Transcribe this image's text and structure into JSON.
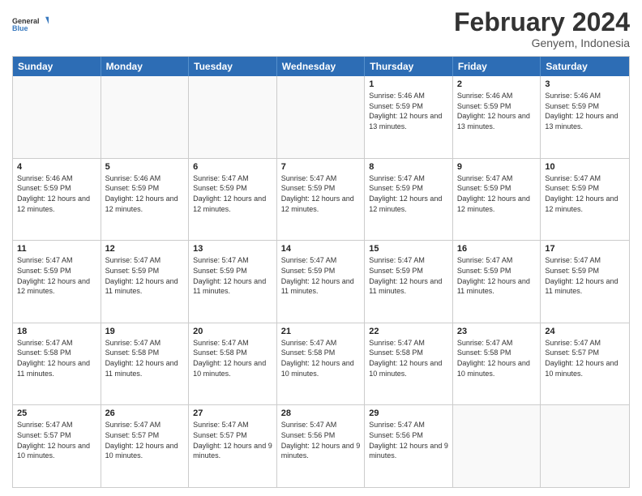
{
  "logo": {
    "line1": "General",
    "line2": "Blue"
  },
  "title": "February 2024",
  "location": "Genyem, Indonesia",
  "days_of_week": [
    "Sunday",
    "Monday",
    "Tuesday",
    "Wednesday",
    "Thursday",
    "Friday",
    "Saturday"
  ],
  "weeks": [
    [
      {
        "day": "",
        "empty": true
      },
      {
        "day": "",
        "empty": true
      },
      {
        "day": "",
        "empty": true
      },
      {
        "day": "",
        "empty": true
      },
      {
        "day": "1",
        "sunrise": "5:46 AM",
        "sunset": "5:59 PM",
        "daylight": "12 hours and 13 minutes."
      },
      {
        "day": "2",
        "sunrise": "5:46 AM",
        "sunset": "5:59 PM",
        "daylight": "12 hours and 13 minutes."
      },
      {
        "day": "3",
        "sunrise": "5:46 AM",
        "sunset": "5:59 PM",
        "daylight": "12 hours and 13 minutes."
      }
    ],
    [
      {
        "day": "4",
        "sunrise": "5:46 AM",
        "sunset": "5:59 PM",
        "daylight": "12 hours and 12 minutes."
      },
      {
        "day": "5",
        "sunrise": "5:46 AM",
        "sunset": "5:59 PM",
        "daylight": "12 hours and 12 minutes."
      },
      {
        "day": "6",
        "sunrise": "5:47 AM",
        "sunset": "5:59 PM",
        "daylight": "12 hours and 12 minutes."
      },
      {
        "day": "7",
        "sunrise": "5:47 AM",
        "sunset": "5:59 PM",
        "daylight": "12 hours and 12 minutes."
      },
      {
        "day": "8",
        "sunrise": "5:47 AM",
        "sunset": "5:59 PM",
        "daylight": "12 hours and 12 minutes."
      },
      {
        "day": "9",
        "sunrise": "5:47 AM",
        "sunset": "5:59 PM",
        "daylight": "12 hours and 12 minutes."
      },
      {
        "day": "10",
        "sunrise": "5:47 AM",
        "sunset": "5:59 PM",
        "daylight": "12 hours and 12 minutes."
      }
    ],
    [
      {
        "day": "11",
        "sunrise": "5:47 AM",
        "sunset": "5:59 PM",
        "daylight": "12 hours and 12 minutes."
      },
      {
        "day": "12",
        "sunrise": "5:47 AM",
        "sunset": "5:59 PM",
        "daylight": "12 hours and 11 minutes."
      },
      {
        "day": "13",
        "sunrise": "5:47 AM",
        "sunset": "5:59 PM",
        "daylight": "12 hours and 11 minutes."
      },
      {
        "day": "14",
        "sunrise": "5:47 AM",
        "sunset": "5:59 PM",
        "daylight": "12 hours and 11 minutes."
      },
      {
        "day": "15",
        "sunrise": "5:47 AM",
        "sunset": "5:59 PM",
        "daylight": "12 hours and 11 minutes."
      },
      {
        "day": "16",
        "sunrise": "5:47 AM",
        "sunset": "5:59 PM",
        "daylight": "12 hours and 11 minutes."
      },
      {
        "day": "17",
        "sunrise": "5:47 AM",
        "sunset": "5:59 PM",
        "daylight": "12 hours and 11 minutes."
      }
    ],
    [
      {
        "day": "18",
        "sunrise": "5:47 AM",
        "sunset": "5:58 PM",
        "daylight": "12 hours and 11 minutes."
      },
      {
        "day": "19",
        "sunrise": "5:47 AM",
        "sunset": "5:58 PM",
        "daylight": "12 hours and 11 minutes."
      },
      {
        "day": "20",
        "sunrise": "5:47 AM",
        "sunset": "5:58 PM",
        "daylight": "12 hours and 10 minutes."
      },
      {
        "day": "21",
        "sunrise": "5:47 AM",
        "sunset": "5:58 PM",
        "daylight": "12 hours and 10 minutes."
      },
      {
        "day": "22",
        "sunrise": "5:47 AM",
        "sunset": "5:58 PM",
        "daylight": "12 hours and 10 minutes."
      },
      {
        "day": "23",
        "sunrise": "5:47 AM",
        "sunset": "5:58 PM",
        "daylight": "12 hours and 10 minutes."
      },
      {
        "day": "24",
        "sunrise": "5:47 AM",
        "sunset": "5:57 PM",
        "daylight": "12 hours and 10 minutes."
      }
    ],
    [
      {
        "day": "25",
        "sunrise": "5:47 AM",
        "sunset": "5:57 PM",
        "daylight": "12 hours and 10 minutes."
      },
      {
        "day": "26",
        "sunrise": "5:47 AM",
        "sunset": "5:57 PM",
        "daylight": "12 hours and 10 minutes."
      },
      {
        "day": "27",
        "sunrise": "5:47 AM",
        "sunset": "5:57 PM",
        "daylight": "12 hours and 9 minutes."
      },
      {
        "day": "28",
        "sunrise": "5:47 AM",
        "sunset": "5:56 PM",
        "daylight": "12 hours and 9 minutes."
      },
      {
        "day": "29",
        "sunrise": "5:47 AM",
        "sunset": "5:56 PM",
        "daylight": "12 hours and 9 minutes."
      },
      {
        "day": "",
        "empty": true
      },
      {
        "day": "",
        "empty": true
      }
    ]
  ],
  "labels": {
    "sunrise": "Sunrise:",
    "sunset": "Sunset:",
    "daylight": "Daylight:"
  }
}
